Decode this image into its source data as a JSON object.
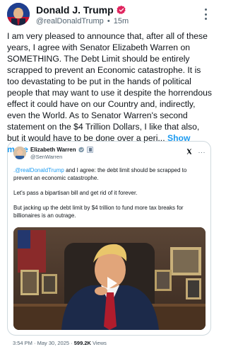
{
  "post": {
    "author_name": "Donald J. Trump",
    "handle": "@realDonaldTrump",
    "separator": "•",
    "time_ago": "15m",
    "text": "I am very pleased to announce that, after all of these years, I agree with Senator Elizabeth Warren on SOMETHING. The Debt Limit should be entirely scrapped to prevent an Economic catastrophe. It is too devastating to be put in the hands of political people that may want to use it despite the horrendous effect it could have on our Country and, indirectly, even the World. As to Senator Warren's second statement on the $4 Trillion Dollars, I like that also, but it would have to be done over a peri...",
    "show_more_label": "Show more"
  },
  "quoted": {
    "author_name": "Elizabeth Warren",
    "handle": "@SenWarren",
    "mention": ".@realDonaldTrump",
    "line1_rest": " and I agree: the debt limit should be scrapped to prevent an economic catastrophe.",
    "line2": "Let's pass a bipartisan bill and get rid of it forever.",
    "line3": "But jacking up the debt limit by $4 trillion to fund more tax breaks for billionaires is an outrage.",
    "more_label": "···",
    "footer": {
      "time": "3:54 PM",
      "sep1": " · ",
      "date": "May 30, 2025",
      "sep2": " · ",
      "views_count": "599.2K",
      "views_label": " Views"
    }
  },
  "icons": {
    "verified": "verified-badge-icon",
    "government": "government-badge-icon",
    "x_logo": "x-logo-icon",
    "more": "more-vertical-icon",
    "play": "play-icon"
  },
  "colors": {
    "link": "#1d9bf0",
    "text": "#0f1419",
    "secondary": "#536471",
    "verified_badge": "#e0245e",
    "border": "#cfd9de"
  }
}
